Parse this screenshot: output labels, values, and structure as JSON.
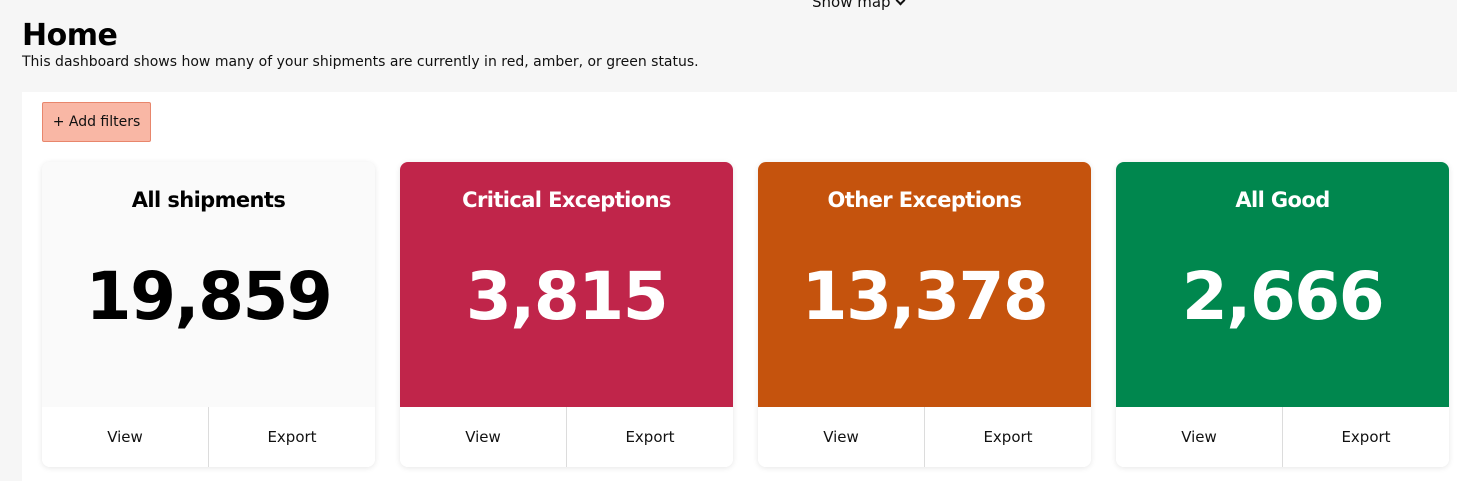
{
  "header": {
    "show_map_label": "Show map",
    "title": "Home",
    "subtitle": "This dashboard shows how many of your shipments are currently in red, amber, or green status."
  },
  "toolbar": {
    "add_filters_label": "+ Add filters"
  },
  "cards": [
    {
      "title": "All shipments",
      "count": "19,859",
      "view_label": "View",
      "export_label": "Export",
      "color": "#fafafa"
    },
    {
      "title": "Critical Exceptions",
      "count": "3,815",
      "view_label": "View",
      "export_label": "Export",
      "color": "#c0254a"
    },
    {
      "title": "Other Exceptions",
      "count": "13,378",
      "view_label": "View",
      "export_label": "Export",
      "color": "#c5530d"
    },
    {
      "title": "All Good",
      "count": "2,666",
      "view_label": "View",
      "export_label": "Export",
      "color": "#00874e"
    }
  ],
  "theme": {
    "page_background": "#f6f6f6",
    "filter_button": "#f9b7a5"
  }
}
